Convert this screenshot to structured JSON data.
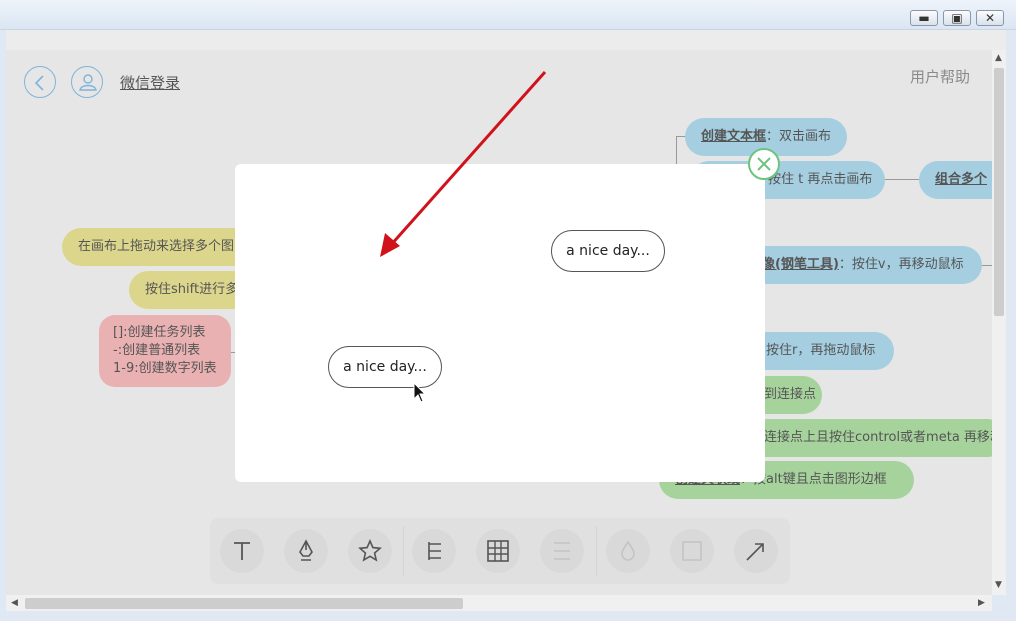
{
  "header": {
    "login_label": "微信登录",
    "help_label": "用户帮助"
  },
  "mindmap": {
    "blue_nodes": [
      {
        "bold": "创建文本框",
        "text": "：双击画布"
      },
      {
        "bold": "",
        "text": "按住 t 再点击画布"
      },
      {
        "bold": "组合多个",
        "text": ""
      },
      {
        "bold": "像(钢笔工具)",
        "text": "：按住v，再移动鼠标"
      },
      {
        "bold": "",
        "text": "按住r，再拖动鼠标"
      }
    ],
    "yellow_nodes": [
      "在画布上拖动来选择多个图",
      "按住shift进行多"
    ],
    "pink_node": [
      "[]:创建任务列表",
      "-:创建普通列表",
      "1-9:创建数字列表"
    ],
    "green_nodes": [
      "到连接点",
      "连接点上且按住control或者meta 再移动",
      {
        "bold": "创建关联线",
        "text": "：按alt键且点击图形边框"
      }
    ]
  },
  "modal": {
    "pill_1": "a nice day...",
    "pill_2": "a nice day..."
  },
  "tools": [
    {
      "icon": "text-tool-icon"
    },
    {
      "icon": "pen-tool-icon"
    },
    {
      "icon": "star-tool-icon"
    },
    {
      "icon": "tree-layout-icon"
    },
    {
      "icon": "table-tool-icon"
    },
    {
      "icon": "list-tool-icon"
    },
    {
      "icon": "fill-color-icon"
    },
    {
      "icon": "border-tool-icon"
    },
    {
      "icon": "arrow-tool-icon"
    }
  ],
  "colors": {
    "accent_blue": "#a5cfe0",
    "accent_yellow": "#dcd68c",
    "accent_pink": "#e9b1b2",
    "accent_green": "#a6d39c",
    "close_green": "#6dc37d",
    "annotation_red": "#d0121b"
  }
}
